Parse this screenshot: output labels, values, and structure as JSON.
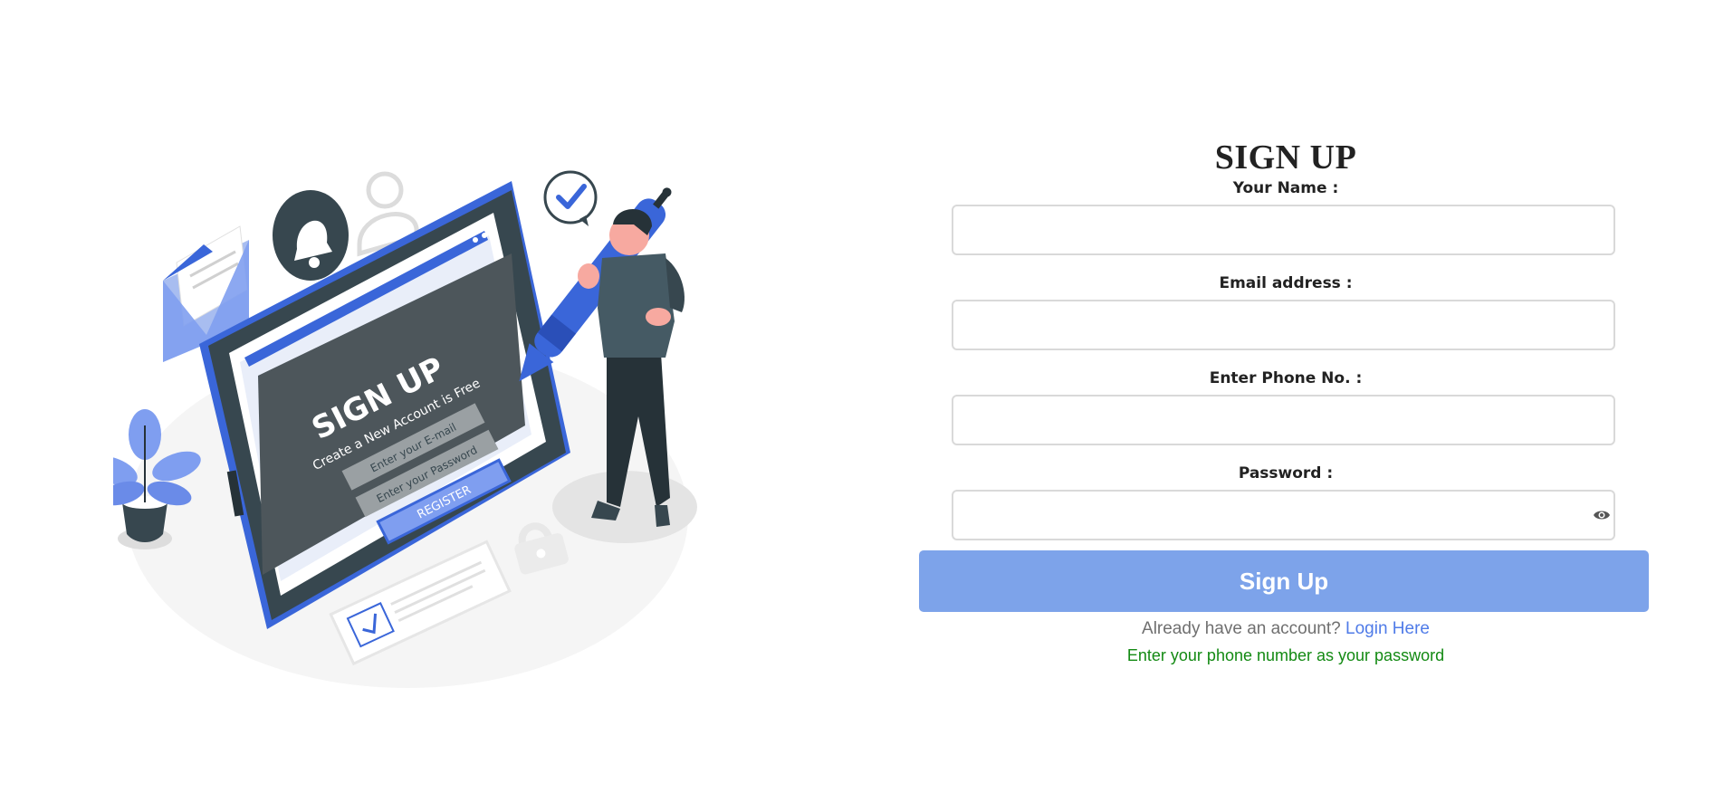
{
  "illustration": {
    "screen_title": "SIGN UP",
    "screen_subtitle": "Create a New Account is Free",
    "email_placeholder": "Enter your E-mail",
    "password_placeholder": "Enter your Password",
    "register_label": "REGISTER"
  },
  "form": {
    "title": "SIGN UP",
    "name_label": "Your Name :",
    "email_label": "Email address :",
    "phone_label": "Enter Phone No. :",
    "password_label": "Password :",
    "name_value": "",
    "email_value": "",
    "phone_value": "",
    "password_value": "",
    "submit_label": "Sign Up",
    "have_account_text": "Already have an account?",
    "login_link_text": "Login Here",
    "hint_text": "Enter your phone number as your password"
  },
  "colors": {
    "accent": "#7da3ea",
    "link": "#4f7be8",
    "hint": "#138a13",
    "illustration_blue": "#3a66d9",
    "illustration_dark": "#37474f"
  },
  "icons": {
    "password_toggle": "eye-icon"
  }
}
